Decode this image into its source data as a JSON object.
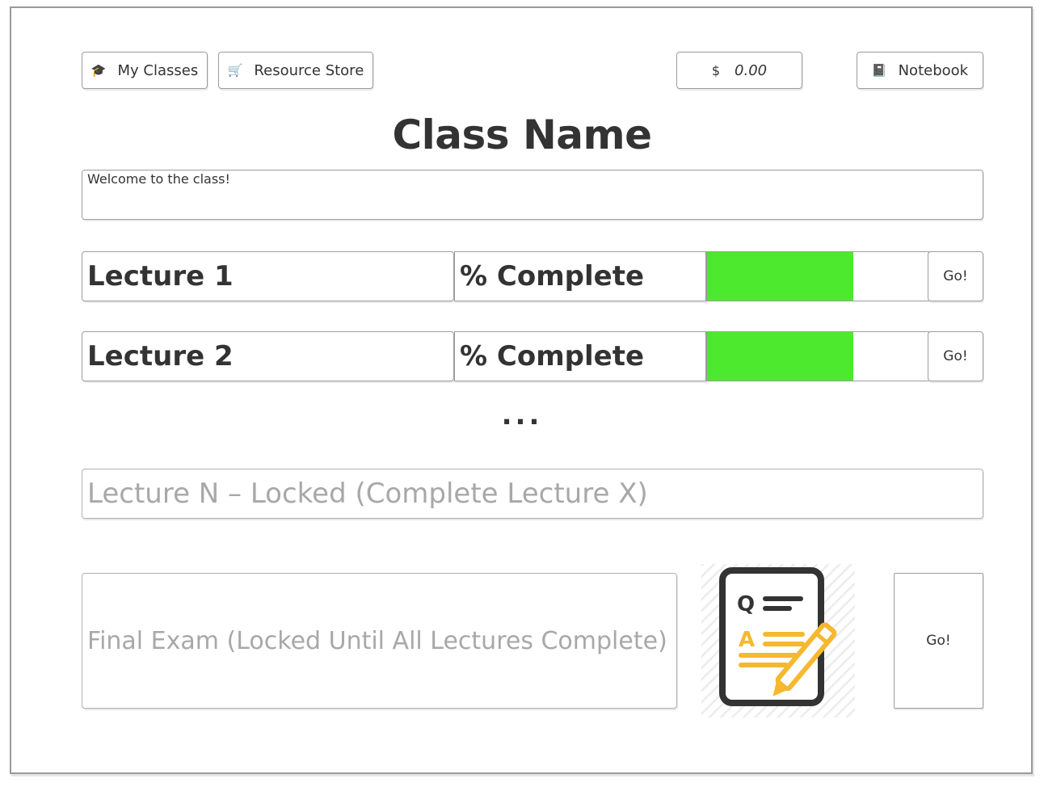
{
  "topbar": {
    "my_classes": {
      "label": "My Classes",
      "icon": "graduation-cap-icon"
    },
    "resource_store": {
      "label": "Resource Store",
      "icon": "cart-icon"
    },
    "balance": {
      "currency": "$",
      "amount": "0.00"
    },
    "notebook": {
      "label": "Notebook",
      "icon": "notebook-icon"
    }
  },
  "class": {
    "title": "Class Name",
    "welcome": "Welcome to the class!"
  },
  "lectures": [
    {
      "name": "Lecture 1",
      "status": "% Complete",
      "progress_percent": 66,
      "go_label": "Go!"
    },
    {
      "name": "Lecture 2",
      "status": "% Complete",
      "progress_percent": 66,
      "go_label": "Go!"
    }
  ],
  "ellipsis": "...",
  "locked_lecture": "Lecture N – Locked (Complete Lecture X)",
  "final_exam": {
    "label": "Final Exam (Locked Until All Lectures Complete)",
    "icon": "exam-paper-icon",
    "go_label": "Go!"
  },
  "colors": {
    "progress_fill": "#4ce92e",
    "locked_text": "#a8a8a8",
    "exam_accent": "#f5b82e"
  }
}
